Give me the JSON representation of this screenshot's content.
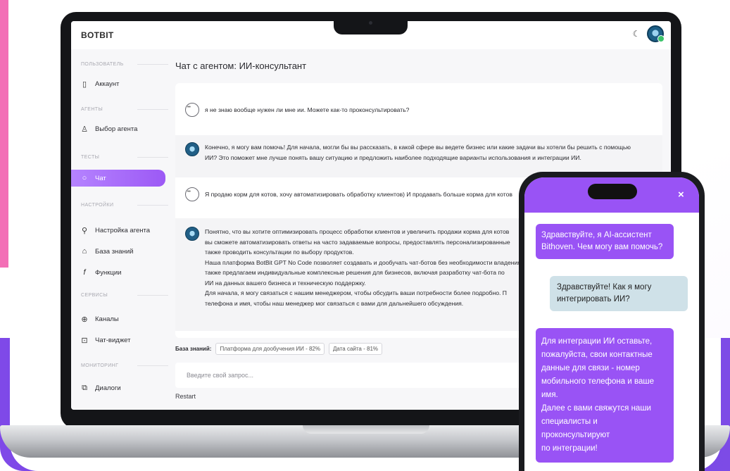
{
  "app": {
    "brand": "BOTBIT",
    "theme_icon": "moon-icon",
    "avatar_icon": "robot-avatar-icon"
  },
  "sidebar": {
    "sections": [
      {
        "label": "ПОЛЬЗОВАТЕЛЬ",
        "items": [
          {
            "label": "Аккаунт",
            "icon": "bookmark-icon"
          }
        ]
      },
      {
        "label": "АГЕНТЫ",
        "items": [
          {
            "label": "Выбор агента",
            "icon": "agent-icon"
          }
        ]
      },
      {
        "label": "ТЕСТЫ",
        "items": [
          {
            "label": "Чат",
            "icon": "chat-bubble-icon",
            "active": true
          }
        ]
      },
      {
        "label": "НАСТРОЙКИ",
        "items": [
          {
            "label": "Настройка агента",
            "icon": "settings-people-icon"
          },
          {
            "label": "База знаний",
            "icon": "library-icon"
          },
          {
            "label": "Функции",
            "icon": "function-icon"
          }
        ]
      },
      {
        "label": "СЕРВИСЫ",
        "items": [
          {
            "label": "Каналы",
            "icon": "globe-icon"
          },
          {
            "label": "Чат-виджет",
            "icon": "widget-icon"
          }
        ]
      },
      {
        "label": "МОНИТОРИНГ",
        "items": [
          {
            "label": "Диалоги",
            "icon": "dialogs-icon"
          }
        ]
      }
    ]
  },
  "chat": {
    "title": "Чат с агентом: ИИ-консультант",
    "messages": [
      {
        "role": "user",
        "lines": [
          "я не знаю вообще нужен ли мне ии. Можете как-то проконсультировать?"
        ]
      },
      {
        "role": "bot",
        "lines": [
          "Конечно, я могу вам помочь! Для начала, могли бы вы рассказать, в какой сфере вы ведете бизнес или какие задачи вы хотели бы решить с помощью",
          "ИИ? Это поможет мне лучше понять вашу ситуацию и предложить наиболее подходящие варианты использования и интеграции ИИ."
        ]
      },
      {
        "role": "user",
        "lines": [
          "Я продаю корм для котов, хочу автоматизировать обработку клиентов) И продавать больше корма для котов"
        ]
      },
      {
        "role": "bot",
        "lines": [
          "Понятно, что вы хотите оптимизировать процесс обработки клиентов и увеличить продажи корма для котов",
          "вы сможете автоматизировать ответы на часто задаваемые вопросы, предоставлять персонализированные",
          "также проводить консультации по выбору продуктов.",
          "Наша платформа BotBit GPT No Code позволяет создавать и дообучать чат-ботов без необходимости владения",
          "также предлагаем индивидуальные комплексные решения для бизнесов, включая разработку чат-бота по",
          "ИИ на данных вашего бизнеса и техническую поддержку.",
          "Для начала, я могу связаться с нашим менеджером, чтобы обсудить ваши потребности более подробно. П",
          "телефона и имя, чтобы наш менеджер мог связаться с вами для дальнейшего обсуждения."
        ]
      }
    ],
    "knowledge_label": "База знаний:",
    "knowledge_chips": [
      "Платформа для дообучения ИИ - 82%",
      "Дата сайта - 81%"
    ],
    "input_placeholder": "Введите свой запрос...",
    "restart_label": "Restart"
  },
  "widget": {
    "close_label": "×",
    "messages": [
      {
        "role": "bot",
        "lines": [
          "Здравствуйте, я AI-ассистент",
          "Bithoven. Чем могу вам помочь?"
        ]
      },
      {
        "role": "user",
        "lines": [
          "Здравствуйте! Как я могу",
          "интегрировать ИИ?"
        ]
      },
      {
        "role": "bot",
        "lines": [
          "Для интеграции ИИ оставьте,",
          "пожалуйста, свои контактные",
          "данные для связи - номер",
          "мобильного телефона и ваше имя.",
          "Далее с вами свяжутся наши",
          "специалисты и проконсультируют",
          "по интеграции!"
        ]
      }
    ]
  },
  "colors": {
    "accent": "#9953f5",
    "active_nav_from": "#b583ff",
    "active_nav_to": "#9c59f5",
    "user_bubble": "#cfe1e8"
  }
}
